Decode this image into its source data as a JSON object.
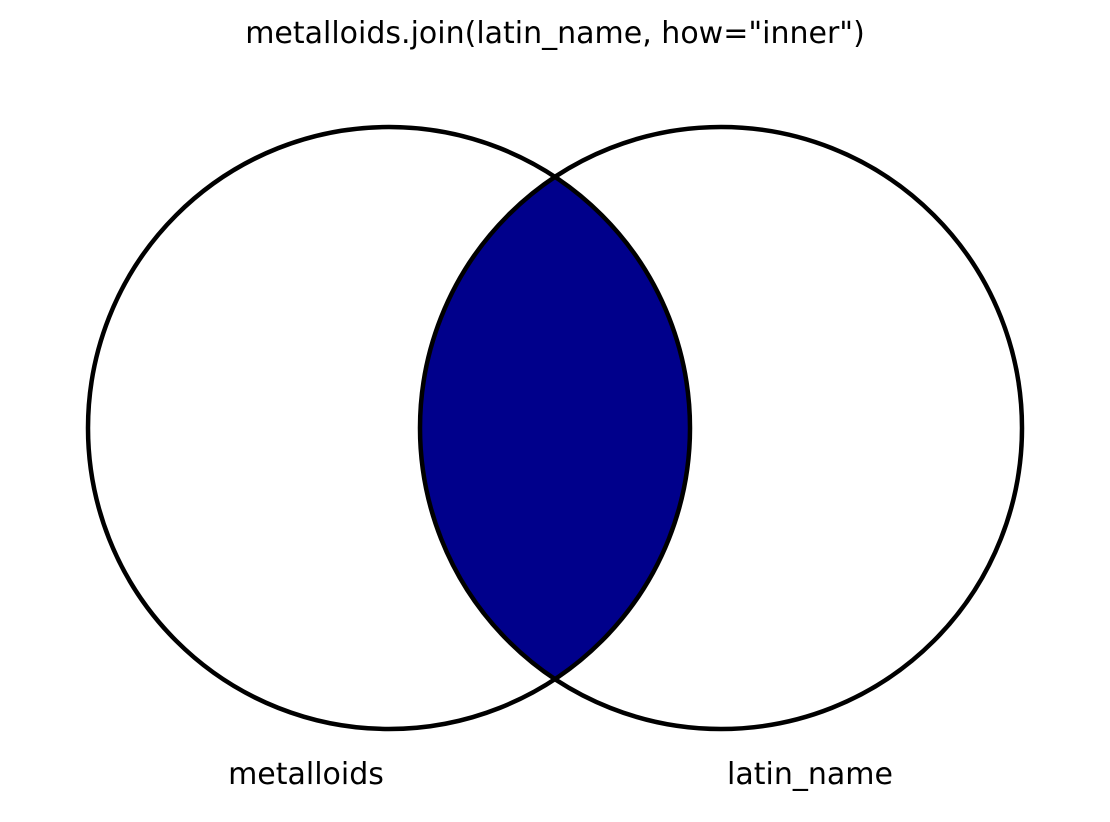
{
  "diagram": {
    "type": "venn",
    "title": "metalloids.join(latin_name, how=\"inner\")",
    "left_set": {
      "label": "metalloids"
    },
    "right_set": {
      "label": "latin_name"
    },
    "highlighted_region": "intersection",
    "colors": {
      "highlight": "#00008b",
      "outline": "#000000",
      "background": "#ffffff"
    }
  }
}
